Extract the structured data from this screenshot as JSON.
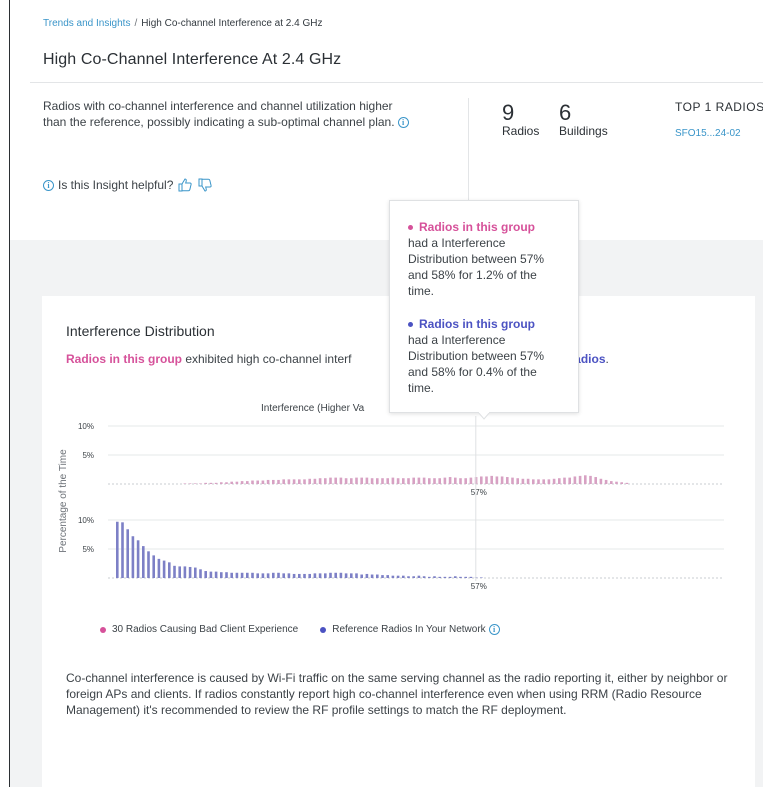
{
  "breadcrumb": {
    "parent": "Trends and Insights",
    "separator": "/",
    "current": "High Co-channel Interference at 2.4 GHz"
  },
  "page_title": "High Co-Channel Interference At 2.4 GHz",
  "description": "Radios with co-channel interference and channel utilization higher than the reference, possibly indicating a sub-optimal channel plan.",
  "helpful_prompt": "Is this Insight helpful?",
  "stats": {
    "radios": {
      "value": "9",
      "label": "Radios"
    },
    "buildings": {
      "value": "6",
      "label": "Buildings"
    },
    "top_radios_title": "TOP 1 RADIOS",
    "top_radio_link": "SFO15...24-02"
  },
  "card": {
    "title": "Interference Distribution",
    "subtitle_group": "Radios in this group",
    "subtitle_mid": " exhibited high co-channel interf",
    "subtitle_ref": "erence radios",
    "subtitle_end": "."
  },
  "tooltip": {
    "group_label": "Radios in this group",
    "group_text": "had a Interference Distribution between 57% and 58% for 1.2% of the time.",
    "ref_label": "Radios in this group",
    "ref_text": "had a Interference Distribution between 57% and 58% for 0.4% of the time."
  },
  "legend": {
    "group": "30 Radios Causing Bad Client Experience",
    "reference": "Reference Radios In Your Network"
  },
  "footer_text": "Co-channel interference is caused by Wi-Fi traffic on the same serving channel as the radio reporting it, either by neighbor or foreign APs and clients. If radios constantly report high co-channel interference even when using RRM (Radio Resource Management) it's recommended to review the RF profile settings to match the RF deployment.",
  "colors": {
    "group": "#d7a1c3",
    "group_text": "#d6519a",
    "reference": "#7d80c6",
    "reference_text": "#4b52c2",
    "link": "#3a95c9"
  },
  "chart_data": {
    "type": "bar",
    "title": "Interference (Higher Va",
    "ylabel": "Percentage of the Time",
    "y_ticks": [
      "10%",
      "5%"
    ],
    "x_marker": "57%",
    "ylim": [
      0,
      10
    ],
    "series": [
      {
        "name": "30 Radios Causing Bad Client Experience",
        "values": [
          0,
          0,
          0,
          0,
          0,
          0,
          0,
          0,
          0,
          0,
          0,
          0,
          0,
          0.1,
          0.1,
          0.1,
          0.1,
          0.2,
          0.2,
          0.2,
          0.3,
          0.3,
          0.4,
          0.4,
          0.5,
          0.5,
          0.6,
          0.6,
          0.6,
          0.7,
          0.7,
          0.7,
          0.8,
          0.8,
          0.8,
          0.8,
          0.8,
          0.9,
          0.9,
          1.0,
          1.0,
          1.1,
          1.1,
          1.1,
          1.0,
          1.0,
          1.1,
          1.1,
          1.1,
          1.0,
          1.0,
          1.0,
          1.0,
          1.1,
          1.0,
          1.0,
          1.0,
          1.1,
          1.1,
          1.1,
          1.0,
          1.0,
          1.0,
          1.1,
          1.2,
          1.1,
          1.0,
          1.0,
          1.1,
          1.2,
          1.3,
          1.3,
          1.4,
          1.3,
          1.3,
          1.2,
          1.1,
          1.0,
          0.9,
          0.9,
          0.8,
          0.8,
          0.8,
          0.8,
          0.9,
          1.0,
          1.1,
          1.1,
          1.3,
          1.4,
          1.5,
          1.4,
          1.2,
          0.9,
          0.7,
          0.5,
          0.4,
          0.3,
          0.2
        ]
      },
      {
        "name": "Reference Radios In Your Network",
        "values": [
          9.7,
          9.6,
          8.4,
          7.2,
          6.5,
          5.5,
          4.6,
          3.9,
          3.3,
          3.0,
          2.7,
          2.1,
          2.0,
          2.0,
          1.9,
          1.8,
          1.5,
          1.2,
          1.1,
          1.1,
          1.0,
          1.0,
          0.9,
          0.9,
          0.9,
          0.9,
          0.9,
          0.8,
          0.8,
          0.8,
          0.9,
          0.9,
          0.8,
          0.8,
          0.7,
          0.7,
          0.7,
          0.7,
          0.8,
          0.8,
          0.8,
          0.9,
          0.9,
          0.9,
          0.8,
          0.8,
          0.8,
          0.6,
          0.7,
          0.6,
          0.6,
          0.5,
          0.5,
          0.4,
          0.4,
          0.4,
          0.3,
          0.3,
          0.4,
          0.3,
          0.2,
          0.3,
          0.2,
          0.2,
          0.2,
          0.3,
          0.2,
          0.2,
          0.2,
          0.1,
          0.1
        ]
      }
    ]
  }
}
